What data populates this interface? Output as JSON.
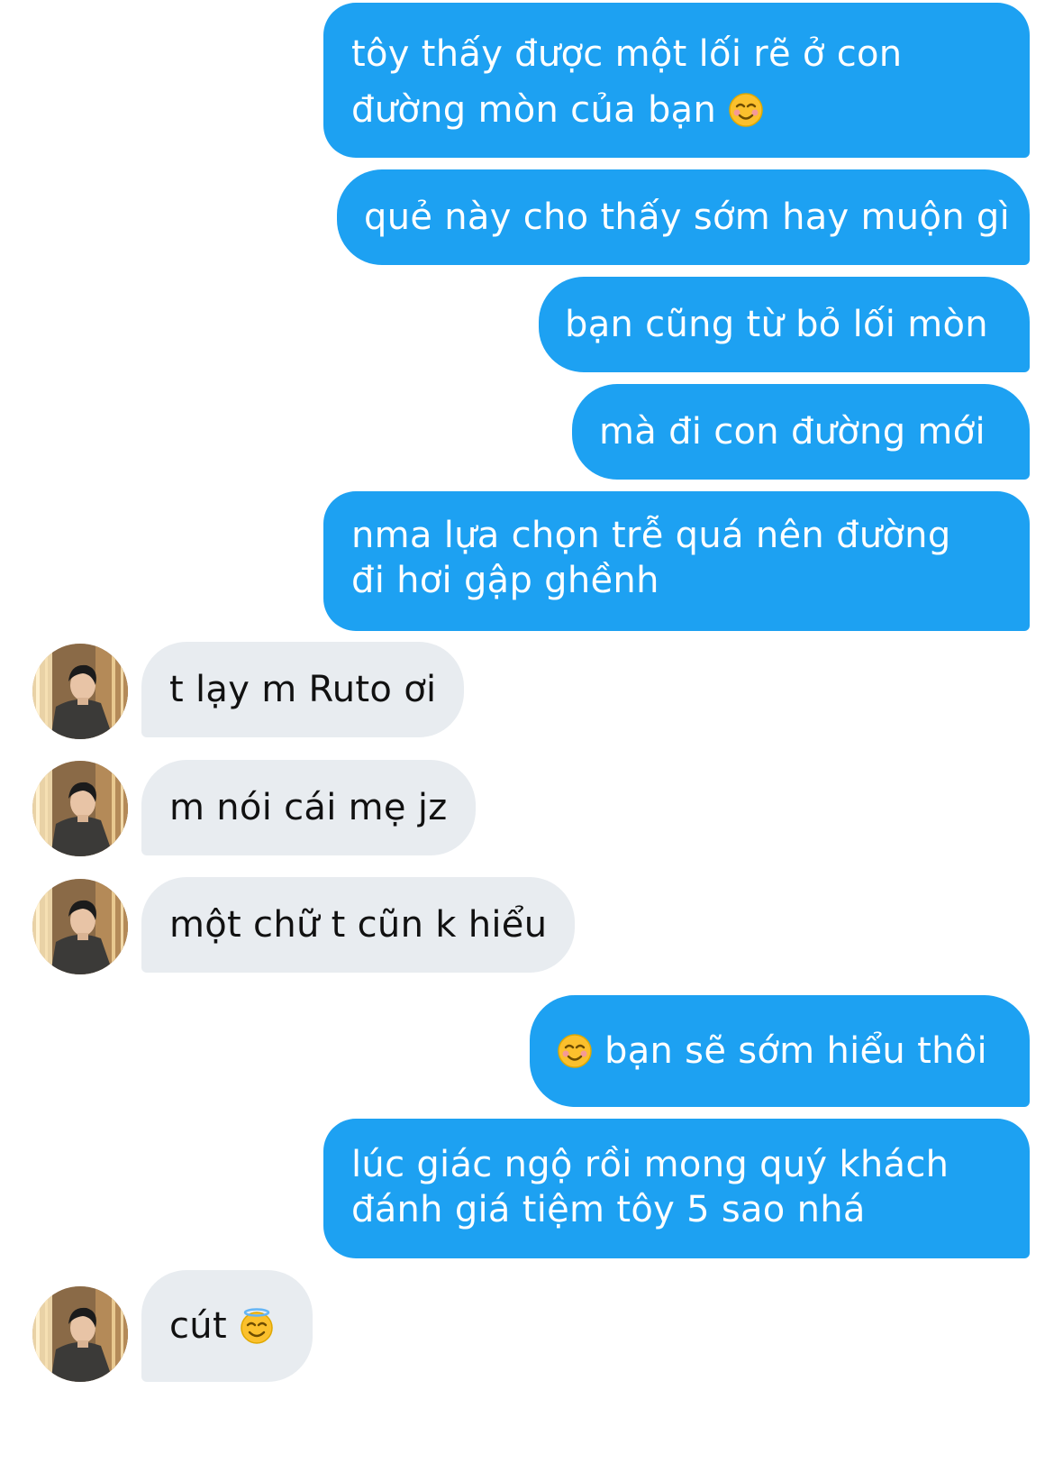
{
  "conversation": {
    "messages": [
      {
        "text": "tôy thấy được một lối rẽ ở con đường mòn của bạn",
        "emoji_name": "smiling-face-icon"
      },
      {
        "text": "quẻ này cho thấy sớm hay muộn gì"
      },
      {
        "text": "bạn cũng từ bỏ lối mòn"
      },
      {
        "text": "mà đi con đường mới"
      },
      {
        "text": "nma lựa chọn trễ quá nên đường đi hơi gập ghềnh"
      },
      {
        "text": "t lạy m Ruto ơi"
      },
      {
        "text": "m nói cái mẹ jz"
      },
      {
        "text": "một chữ t cũn k hiểu"
      },
      {
        "text": "bạn sẽ sớm hiểu thôi",
        "emoji_name": "smiling-face-icon"
      },
      {
        "text": "lúc giác ngộ rồi mong quý khách đánh giá tiệm tôy 5 sao nhá"
      },
      {
        "text": "cút",
        "emoji_name": "halo-face-icon"
      }
    ]
  },
  "colors": {
    "outgoing_bubble": "#1da1f2",
    "incoming_bubble": "#e8ecf0",
    "outgoing_text": "#ffffff",
    "incoming_text": "#111111"
  }
}
